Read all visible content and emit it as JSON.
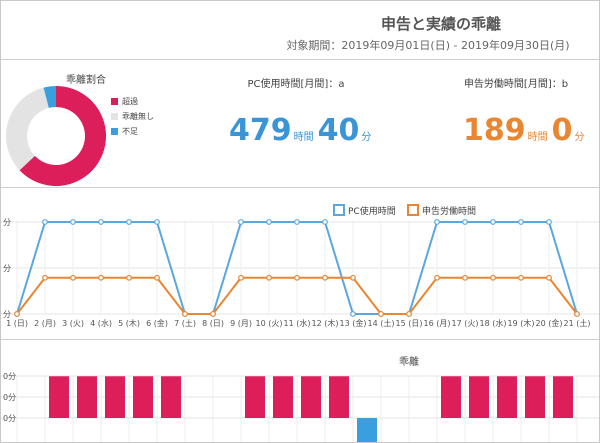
{
  "header": {
    "title": "申告と実績の乖離",
    "period": "対象期間：2019年09月01日(日) - 2019年09月30日(月)"
  },
  "donut": {
    "title": "乖離割合",
    "slices": [
      {
        "label": "超過",
        "value": 63,
        "color": "#dc1e5a"
      },
      {
        "label": "乖離無し",
        "value": 33,
        "color": "#e3e3e3"
      },
      {
        "label": "不足",
        "value": 4,
        "color": "#3aa0dd"
      }
    ]
  },
  "metrics": {
    "pc": {
      "label": "PC使用時間[月間]：a",
      "hours": "479",
      "hours_unit": "時間",
      "minutes": "40",
      "minutes_unit": "分",
      "color": "#3a95d6"
    },
    "declared": {
      "label": "申告労働時間[月間]：b",
      "hours": "189",
      "hours_unit": "時間",
      "minutes": "0",
      "minutes_unit": "分",
      "color": "#e98632"
    }
  },
  "chart_data": [
    {
      "type": "line",
      "title": "",
      "ylim": [
        0,
        16
      ],
      "y_tick_labels": [
        "分",
        "分",
        "分"
      ],
      "categories": [
        "1 (日)",
        "2 (月)",
        "3 (火)",
        "4 (水)",
        "5 (木)",
        "6 (金)",
        "7 (土)",
        "8 (日)",
        "9 (月)",
        "10 (火)",
        "11 (水)",
        "12 (木)",
        "13 (金)",
        "14 (土)",
        "15 (日)",
        "16 (月)",
        "17 (火)",
        "18 (水)",
        "19 (木)",
        "20 (金)",
        "21 (土)"
      ],
      "series": [
        {
          "name": "PC使用時間",
          "color": "#5aa7dd",
          "values": [
            0,
            16,
            16,
            16,
            16,
            16,
            0,
            0,
            16,
            16,
            16,
            16,
            0,
            0,
            0,
            16,
            16,
            16,
            16,
            16,
            0
          ]
        },
        {
          "name": "申告労働時間",
          "color": "#e98632",
          "values": [
            0,
            6.3,
            6.3,
            6.3,
            6.3,
            6.3,
            0,
            0,
            6.3,
            6.3,
            6.3,
            6.3,
            6.3,
            0,
            0,
            6.3,
            6.3,
            6.3,
            6.3,
            6.3,
            0
          ]
        }
      ],
      "legend": "top-center",
      "grid": true
    },
    {
      "type": "bar",
      "title": "乖離",
      "y_tick_labels": [
        "0分",
        "0分",
        "0分"
      ],
      "categories": [
        "1 (日)",
        "2 (月)",
        "3 (火)",
        "4 (水)",
        "5 (木)",
        "6 (金)",
        "7 (土)",
        "8 (日)",
        "9 (月)",
        "10 (火)",
        "11 (水)",
        "12 (木)",
        "13 (金)",
        "14 (土)",
        "15 (日)",
        "16 (月)",
        "17 (火)",
        "18 (水)",
        "19 (木)",
        "20 (金)",
        "21 (土)"
      ],
      "values": [
        0,
        9.7,
        9.7,
        9.7,
        9.7,
        9.7,
        0,
        0,
        9.7,
        9.7,
        9.7,
        9.7,
        -6.3,
        0,
        0,
        9.7,
        9.7,
        9.7,
        9.7,
        9.7,
        0
      ],
      "positive_color": "#dc1e5a",
      "negative_color": "#3aa0dd",
      "grid": true
    }
  ]
}
